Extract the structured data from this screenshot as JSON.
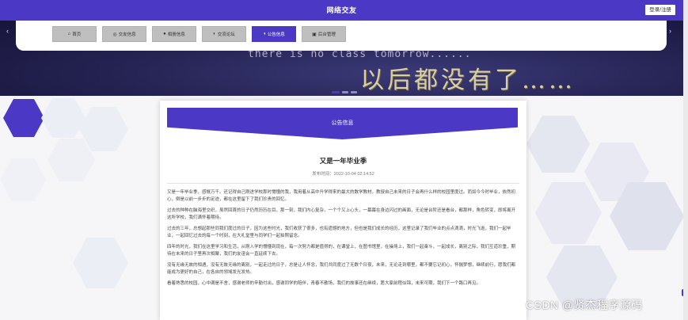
{
  "header": {
    "title": "网络交友",
    "login_label": "登录/注册"
  },
  "nav": {
    "items": [
      {
        "label": "首页",
        "icon": "home-icon",
        "glyph": "⌂"
      },
      {
        "label": "交友信息",
        "icon": "users-icon",
        "glyph": "◎"
      },
      {
        "label": "相册信息",
        "icon": "photo-icon",
        "glyph": "●"
      },
      {
        "label": "交流论坛",
        "icon": "forum-icon",
        "glyph": "◐"
      },
      {
        "label": "公告信息",
        "icon": "notice-icon",
        "glyph": "◑",
        "active": true
      },
      {
        "label": "后台管理",
        "icon": "admin-icon",
        "glyph": "▣"
      }
    ]
  },
  "banner": {
    "english_text": "there is no class tomorrow......",
    "chinese_text": "以后都没有了……"
  },
  "section": {
    "title": "公告信息"
  },
  "article": {
    "title": "又是一年毕业季",
    "meta": "发布时间：2022-10-04 02:14:52",
    "paragraphs": [
      "又是一年毕业季，感慨万千。还记得自己刚进学校那时懵懂的我，我用着从高中升学得来的最大的数学教材，教授自己未来的日子会再什么样的校园里度过。而如今今时毕业，依然初心，倒是以前一步步的足迹，都在这里留下了我们珍贵的回忆。",
      "过去的种种在脑海里交织，虽然回首的日子仍然历历在目，那一刻，我们内心复杂，一个个又上心头，一幕幕在身边闪过的画面，无论是台阶还是看台，都那样，角色转变，即将离开这所学校，我们满怀着期待。",
      "过去的三年，总想起那些同我们度过的日子，因为这些时光，我们收获了很多，也有遗憾的地方，但也是我们成长的经历，这里记录了我们毕业的点点滴滴，时光飞逝，我们一起毕业，一起回忆过去的每一个时刻，在大礼堂里与同学们一起拍照留念。",
      "四年的时光，我们在这里学习和生活，从刚入学的懵懂到现在，每一次努力都是值得的，在课堂上，在图书馆里，在操场上，我们一起奋斗，一起成长，离别之际，我们互道珍重，期待在未来的日子里再次相聚，我们的友谊会一直延续下去。",
      "没有无缘无故的相遇，没有无故无缘的离别，一起走过的日子，总是让人怀念，我们共同度过了无数个日夜，未来，无论走到哪里，都不要忘记初心，怀揣梦想，继续前行，愿我们都能成为更好的自己，在各自的领域发光发热。",
      "看着熟悉的校园，心中满是不舍，感谢老师的辛勤付出，感谢同学的陪伴，青春不散场，我们的故事还在继续，愿大家前程似锦，未来可期，我们下一个路口再见。"
    ]
  },
  "watermark": "CSDN @贤杰程序源码",
  "colors": {
    "primary": "#4b39c6",
    "nav_inactive": "#bfbfbf",
    "hexagon": "#e3e4ee"
  }
}
